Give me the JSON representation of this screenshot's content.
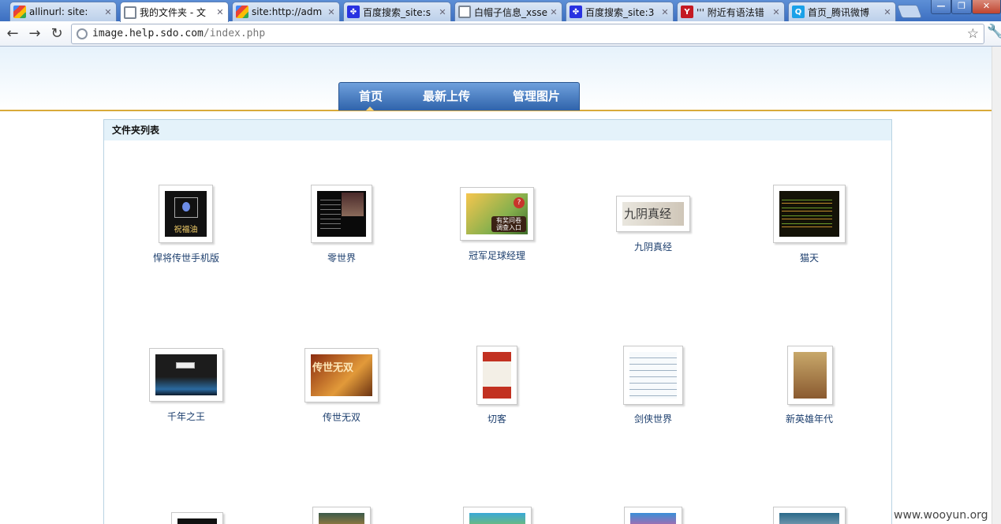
{
  "browser": {
    "tabs": [
      {
        "title": "allinurl: site:",
        "favicon": "google-icon",
        "active": false
      },
      {
        "title": "我的文件夹 - 文",
        "favicon": "globe-icon",
        "active": true
      },
      {
        "title": "site:http://adm",
        "favicon": "google-icon",
        "active": false
      },
      {
        "title": "百度搜索_site:s",
        "favicon": "baidu-icon",
        "active": false
      },
      {
        "title": "白帽子信息_xsse",
        "favicon": "globe-icon",
        "active": false
      },
      {
        "title": "百度搜索_site:3",
        "favicon": "baidu-icon",
        "active": false
      },
      {
        "title": "''' 附近有语法错",
        "favicon": "yahoo-icon",
        "active": false
      },
      {
        "title": "首页_腾讯微博",
        "favicon": "qq-icon",
        "active": false
      }
    ],
    "url_host": "image.help.sdo.com",
    "url_path": "/index.php"
  },
  "nav": {
    "items": [
      "首页",
      "最新上传",
      "管理图片"
    ],
    "active": "首页"
  },
  "panel": {
    "title": "文件夹列表"
  },
  "folders": [
    {
      "label": "悍将传世手机版",
      "thumb_caption": "祝福油"
    },
    {
      "label": "零世界",
      "thumb_caption": ""
    },
    {
      "label": "冠军足球经理",
      "thumb_caption": "有奖问卷 调查入口"
    },
    {
      "label": "九阴真经",
      "thumb_caption": "九阴真经"
    },
    {
      "label": "猫天",
      "thumb_caption": ""
    },
    {
      "label": "千年之王",
      "thumb_caption": ""
    },
    {
      "label": "传世无双",
      "thumb_caption": "传世无双"
    },
    {
      "label": "切客",
      "thumb_caption": ""
    },
    {
      "label": "剑侠世界",
      "thumb_caption": ""
    },
    {
      "label": "新英雄年代",
      "thumb_caption": ""
    },
    {
      "label": "",
      "thumb_caption": ""
    },
    {
      "label": "",
      "thumb_caption": ""
    },
    {
      "label": "",
      "thumb_caption": ""
    },
    {
      "label": "",
      "thumb_caption": ""
    },
    {
      "label": "",
      "thumb_caption": ""
    }
  ],
  "watermark": "www.wooyun.org"
}
